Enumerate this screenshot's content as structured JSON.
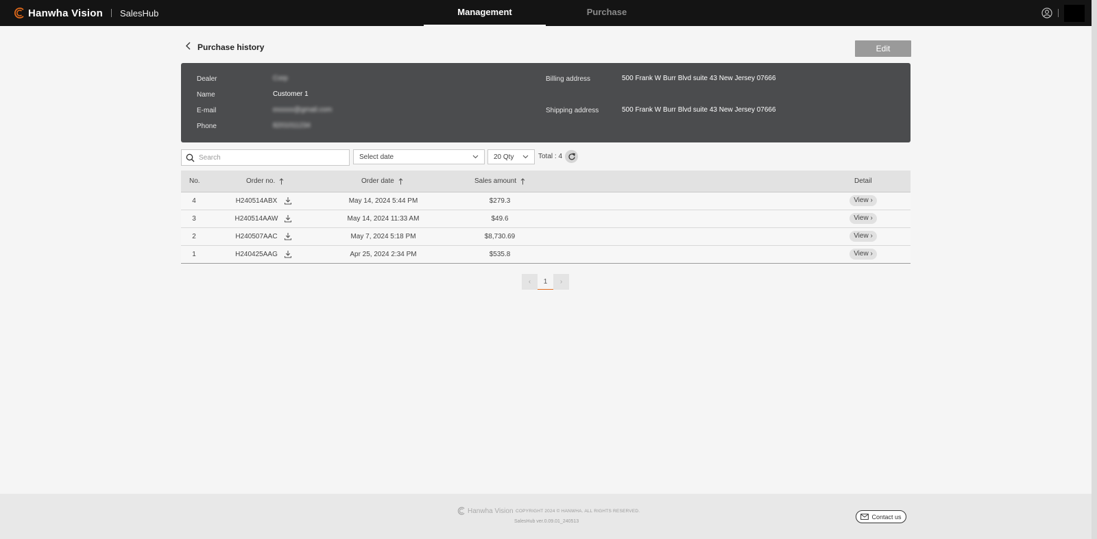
{
  "header": {
    "brand_name": "Hanwha Vision",
    "app_name": "SalesHub",
    "tabs": [
      {
        "label": "Management",
        "active": true
      },
      {
        "label": "Purchase",
        "active": false
      }
    ]
  },
  "page": {
    "title": "Purchase history",
    "edit_label": "Edit"
  },
  "customer": {
    "dealer_label": "Dealer",
    "dealer_value": "Corp",
    "name_label": "Name",
    "name_value": "Customer 1",
    "email_label": "E-mail",
    "email_value": "exxxxx@gmail.com",
    "phone_label": "Phone",
    "phone_value": "8201011234",
    "billing_label": "Billing address",
    "billing_value": "500 Frank W Burr Blvd suite 43 New Jersey 07666",
    "shipping_label": "Shipping address",
    "shipping_value": "500 Frank W Burr Blvd suite 43 New Jersey 07666"
  },
  "filters": {
    "search_placeholder": "Search",
    "date_placeholder": "Select date",
    "qty_value": "20 Qty",
    "total_text": "Total : 4"
  },
  "table": {
    "headers": {
      "no": "No.",
      "order_no": "Order no.",
      "order_date": "Order date",
      "sales_amount": "Sales amount",
      "detail": "Detail"
    },
    "rows": [
      {
        "no": "4",
        "order_no": "H240514ABX",
        "order_date": "May 14, 2024 5:44 PM",
        "amount": "$279.3",
        "view": "View"
      },
      {
        "no": "3",
        "order_no": "H240514AAW",
        "order_date": "May 14, 2024 11:33 AM",
        "amount": "$49.6",
        "view": "View"
      },
      {
        "no": "2",
        "order_no": "H240507AAC",
        "order_date": "May 7, 2024 5:18 PM",
        "amount": "$8,730.69",
        "view": "View"
      },
      {
        "no": "1",
        "order_no": "H240425AAG",
        "order_date": "Apr 25, 2024 2:34 PM",
        "amount": "$535.8",
        "view": "View"
      }
    ]
  },
  "pagination": {
    "current_page": "1"
  },
  "footer": {
    "logo_text": "Hanwha Vision",
    "copyright": "COPYRIGHT 2024 © HANWHA. ALL RIGHTS RESERVED.",
    "version": "SalesHub ver.0.09.01_240513",
    "contact_label": "Contact us"
  },
  "colors": {
    "accent": "#e26a1a",
    "topbar": "#141414",
    "card": "#4b4c4e"
  }
}
